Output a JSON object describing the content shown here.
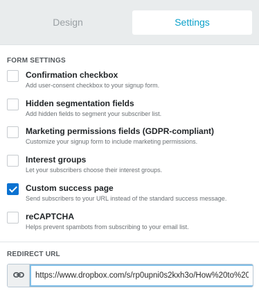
{
  "tabs": [
    {
      "label": "Design",
      "active": false
    },
    {
      "label": "Settings",
      "active": true
    }
  ],
  "form_settings": {
    "heading": "FORM SETTINGS",
    "options": [
      {
        "title": "Confirmation checkbox",
        "description": "Add user-consent checkbox to your signup form.",
        "checked": false
      },
      {
        "title": "Hidden segmentation fields",
        "description": "Add hidden fields to segment your subscriber list.",
        "checked": false
      },
      {
        "title": "Marketing permissions fields (GDPR-compliant)",
        "description": "Customize your signup form to include marketing permissions.",
        "checked": false
      },
      {
        "title": "Interest groups",
        "description": "Let your subscribers choose their interest groups.",
        "checked": false
      },
      {
        "title": "Custom success page",
        "description": "Send subscribers to your URL instead of the standard success message.",
        "checked": true
      },
      {
        "title": "reCAPTCHA",
        "description": "Helps prevent spambots from subscribing to your email list.",
        "checked": false
      }
    ]
  },
  "redirect": {
    "heading": "REDIRECT URL",
    "icon": "link-icon",
    "value": "https://www.dropbox.com/s/rp0upni0s2kxh3o/How%20to%20"
  },
  "colors": {
    "accent": "#0aa0c9",
    "checkbox_checked": "#0b72d1",
    "tab_bar_bg": "#e9eced"
  }
}
